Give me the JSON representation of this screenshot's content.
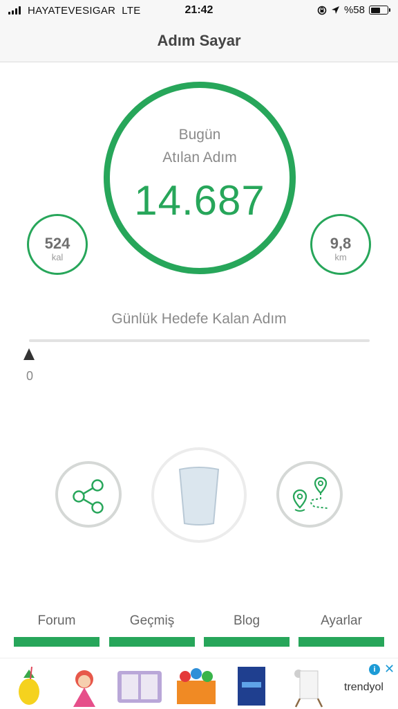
{
  "status_bar": {
    "carrier": "HAYATEVESIGAR",
    "network": "LTE",
    "time": "21:42",
    "battery": "%58",
    "battery_level": 0.58
  },
  "nav": {
    "title": "Adım Sayar"
  },
  "today": {
    "line1": "Bugün",
    "line2": "Atılan Adım",
    "steps": "14.687"
  },
  "calories": {
    "value": "524",
    "unit": "kal"
  },
  "distance": {
    "value": "9,8",
    "unit": "km"
  },
  "goal": {
    "label": "Günlük Hedefe Kalan Adım",
    "remaining": "0",
    "progress": 0
  },
  "actions": {
    "share_icon": "share-icon",
    "water_icon": "water-glass-icon",
    "route_icon": "route-map-icon"
  },
  "tabs": [
    {
      "label": "Forum"
    },
    {
      "label": "Geçmiş"
    },
    {
      "label": "Blog"
    },
    {
      "label": "Ayarlar"
    }
  ],
  "ad": {
    "brand": "trendyol",
    "info_icon": "i",
    "close_icon": "✕"
  },
  "colors": {
    "accent": "#27a65a",
    "ring_gray": "#d5d8d6",
    "ad_info": "#1d9bd6"
  }
}
